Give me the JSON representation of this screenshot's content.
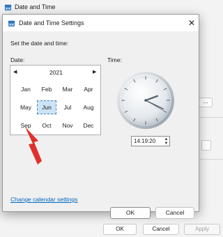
{
  "parent_window": {
    "title": "Date and Time",
    "buttons": {
      "ok": "OK",
      "cancel": "Cancel",
      "apply": "Apply"
    },
    "side_button_label": "..."
  },
  "dialog": {
    "title": "Date and Time Settings",
    "close_glyph": "✕",
    "instruction": "Set the date and time:",
    "date_label": "Date:",
    "time_label": "Time:",
    "calendar": {
      "prev_glyph": "◀",
      "next_glyph": "▶",
      "year": "2021",
      "months": [
        "Jan",
        "Feb",
        "Mar",
        "Apr",
        "May",
        "Jun",
        "Jul",
        "Aug",
        "Sep",
        "Oct",
        "Nov",
        "Dec"
      ],
      "selected": "Jun"
    },
    "clock": {
      "hours": 14,
      "minutes": 19,
      "seconds": 20
    },
    "time_value": "14:19:20",
    "spin_up_glyph": "▲",
    "spin_down_glyph": "▼",
    "change_calendar_link": "Change calendar settings",
    "buttons": {
      "ok": "OK",
      "cancel": "Cancel"
    }
  },
  "colors": {
    "accent": "#0067c0",
    "selection_fill": "#cce4f7",
    "annotation_arrow": "#e0302b"
  }
}
